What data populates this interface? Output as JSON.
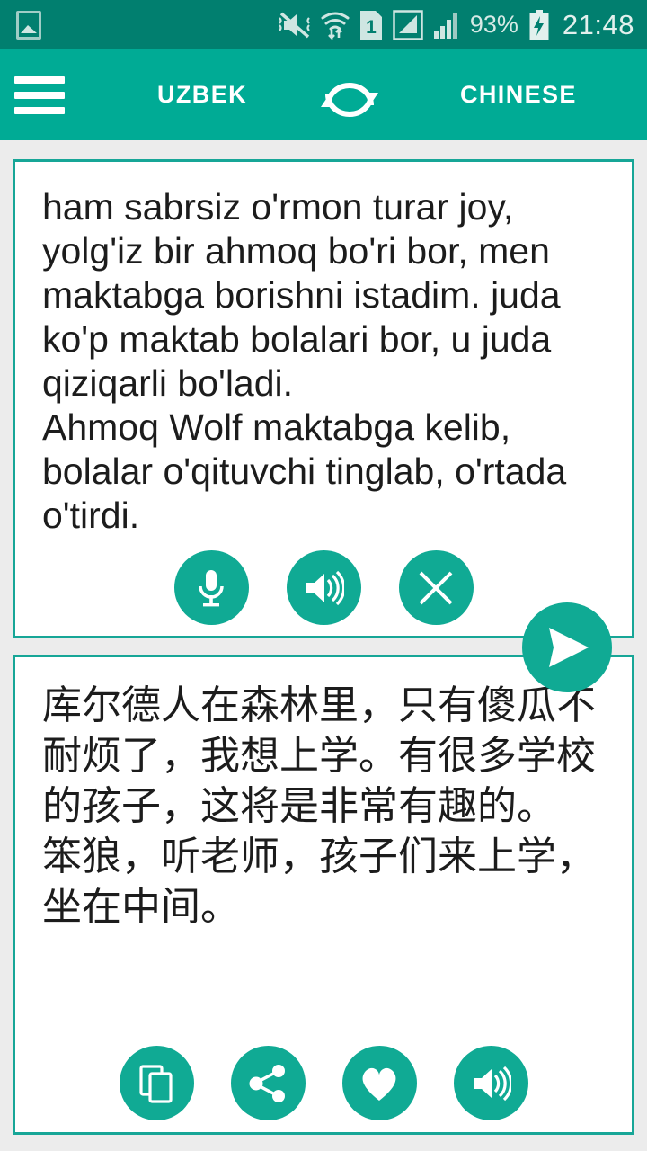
{
  "status_bar": {
    "gallery_icon": "gallery-icon",
    "vibrate_icon": "mute-vibrate-icon",
    "wifi_icon": "wifi-transfer-icon",
    "sim_icon": "sim-1-icon",
    "signal1_icon": "signal-bars-boxed-icon",
    "signal2_icon": "signal-bars-icon",
    "battery_percent": "93%",
    "battery_icon": "battery-charging-icon",
    "time": "21:48"
  },
  "app_bar": {
    "menu_icon": "hamburger-menu-icon",
    "source_language": "UZBEK",
    "swap_icon": "swap-languages-icon",
    "target_language": "CHINESE"
  },
  "source_card": {
    "text": "ham sabrsiz o'rmon turar joy, yolg'iz bir ahmoq bo'ri bor, men maktabga borishni istadim. juda ko'p maktab bolalari bor, u juda qiziqarli bo'ladi.\nAhmoq Wolf maktabga kelib, bolalar o'qituvchi tinglab, o'rtada o'tirdi.",
    "actions": [
      {
        "name": "microphone-button",
        "icon": "microphone-icon"
      },
      {
        "name": "speak-source-button",
        "icon": "speaker-icon"
      },
      {
        "name": "clear-text-button",
        "icon": "close-icon"
      }
    ]
  },
  "translate_button": {
    "name": "translate-send-button",
    "icon": "send-icon"
  },
  "target_card": {
    "text": "库尔德人在森林里，只有傻瓜不耐烦了，我想上学。有很多学校的孩子，这将是非常有趣的。\n笨狼，听老师，孩子们来上学，坐在中间。",
    "actions": [
      {
        "name": "copy-button",
        "icon": "copy-icon"
      },
      {
        "name": "share-button",
        "icon": "share-icon"
      },
      {
        "name": "favorite-button",
        "icon": "heart-icon"
      },
      {
        "name": "speak-target-button",
        "icon": "speaker-icon"
      }
    ]
  },
  "colors": {
    "status_bar": "#017f6f",
    "app_bar": "#00ab95",
    "accent": "#10aa94",
    "card_border": "#17a697",
    "page_background": "#ececec",
    "text": "#1c1c1c"
  }
}
